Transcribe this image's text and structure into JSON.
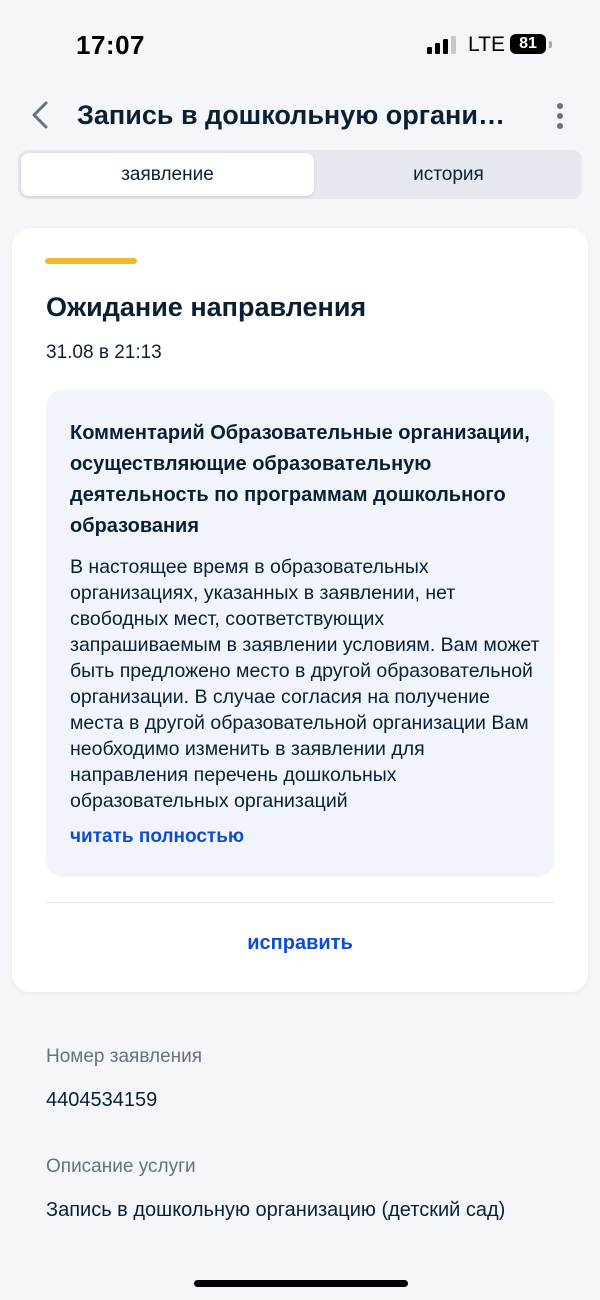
{
  "status_bar": {
    "time": "17:07",
    "network": "LTE",
    "battery": "81"
  },
  "nav": {
    "title": "Запись в дошкольную организацию (детский сад)",
    "back_icon": "chevron-left-icon",
    "more_icon": "more-vertical-icon"
  },
  "tabs": [
    {
      "label": "заявление",
      "active": true
    },
    {
      "label": "история",
      "active": false
    }
  ],
  "status_card": {
    "status": "Ожидание направления",
    "date": "31.08 в 21:13",
    "stripe_color": "#f0b929",
    "comment": {
      "title": "Комментарий Образовательные организации, осуществляющие образовательную деятельность по программам дошкольного образования",
      "text": "В настоящее время в образовательных организациях, указанных в заявлении, нет свободных мест, соответствующих запрашиваемым в заявлении условиям. Вам может быть предложено место в другой образовательной организации. В случае согласия на получение места в другой образовательной организации Вам необходимо изменить в заявлении для направления перечень дошкольных образовательных организаций",
      "read_more": "читать полностью"
    },
    "fix_button": "исправить"
  },
  "details": {
    "number_label": "Номер заявления",
    "number_value": "4404534159",
    "service_label": "Описание услуги",
    "service_value": "Запись в дошкольную организацию (детский сад)"
  },
  "colors": {
    "accent": "#0d4cd3",
    "status_pending": "#f0b929",
    "background": "#f4f6f9"
  }
}
